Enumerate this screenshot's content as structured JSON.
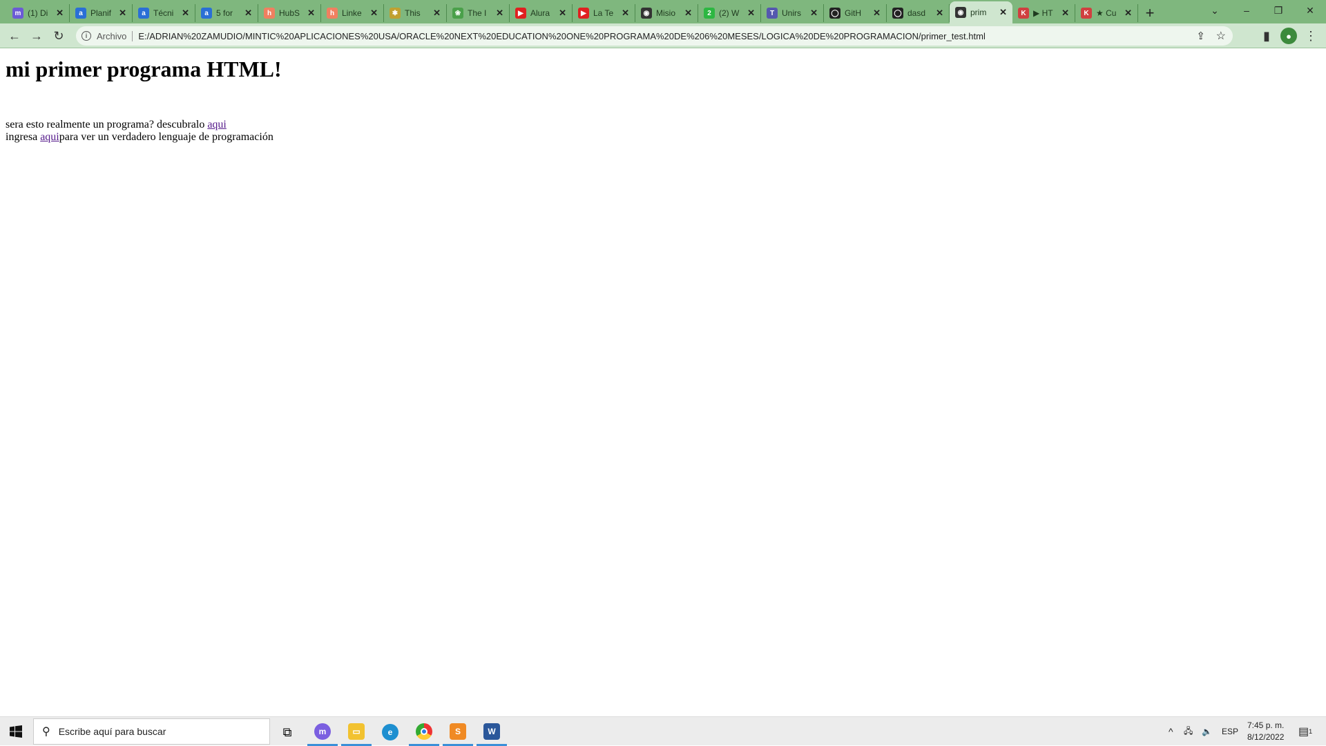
{
  "browser": {
    "tabs": [
      {
        "title": "(1) Di",
        "icon": "messenger-icon",
        "color": "#6b5bd6",
        "glyph": "m"
      },
      {
        "title": "Planif",
        "icon": "alura-icon",
        "color": "#2a6fd6",
        "glyph": "a"
      },
      {
        "title": "Técni",
        "icon": "alura-icon",
        "color": "#2a6fd6",
        "glyph": "a"
      },
      {
        "title": "5 for",
        "icon": "alura-icon",
        "color": "#2a6fd6",
        "glyph": "a"
      },
      {
        "title": "HubS",
        "icon": "hubspot-icon",
        "color": "#f08060",
        "glyph": "h"
      },
      {
        "title": "Linke",
        "icon": "hubspot-icon",
        "color": "#f08060",
        "glyph": "h"
      },
      {
        "title": "This",
        "icon": "nbc-icon",
        "color": "#c0a030",
        "glyph": "✱"
      },
      {
        "title": "The I",
        "icon": "leaf-icon",
        "color": "#4aa04a",
        "glyph": "❀"
      },
      {
        "title": "Alura",
        "icon": "youtube-icon",
        "color": "#e02020",
        "glyph": "▶"
      },
      {
        "title": "La Te",
        "icon": "youtube-icon",
        "color": "#e02020",
        "glyph": "▶"
      },
      {
        "title": "Misio",
        "icon": "globe-icon",
        "color": "#333333",
        "glyph": "◉"
      },
      {
        "title": "(2) W",
        "icon": "whatsapp-icon",
        "color": "#2db742",
        "glyph": "2"
      },
      {
        "title": "Unirs",
        "icon": "teams-icon",
        "color": "#5558af",
        "glyph": "T"
      },
      {
        "title": "GitH",
        "icon": "github-icon",
        "color": "#222222",
        "glyph": "◯"
      },
      {
        "title": "dasd",
        "icon": "github-icon",
        "color": "#222222",
        "glyph": "◯"
      },
      {
        "title": "prim",
        "icon": "globe-icon",
        "color": "#333333",
        "glyph": "◉",
        "active": true
      },
      {
        "title": "▶ HT",
        "icon": "k-icon",
        "color": "#d04040",
        "glyph": "K"
      },
      {
        "title": "★ Cu",
        "icon": "k-icon",
        "color": "#d04040",
        "glyph": "K"
      }
    ],
    "new_tab": "+",
    "address_label": "Archivo",
    "url": "E:/ADRIAN%20ZAMUDIO/MINTIC%20APLICACIONES%20USA/ORACLE%20NEXT%20EDUCATION%20ONE%20PROGRAMA%20DE%206%20MESES/LOGICA%20DE%20PROGRAMACION/primer_test.html"
  },
  "page": {
    "heading": "mi primer programa HTML!",
    "line1_text": "sera esto realmente un programa? descubralo ",
    "line1_link": "aqui",
    "line2_prefix": "ingresa ",
    "line2_link": "aqui",
    "line2_suffix": "para ver un verdadero lenguaje de programación"
  },
  "taskbar": {
    "search_placeholder": "Escribe aquí para buscar",
    "language": "ESP",
    "time": "7:45 p. m.",
    "date": "8/12/2022",
    "notification_count": "1"
  }
}
